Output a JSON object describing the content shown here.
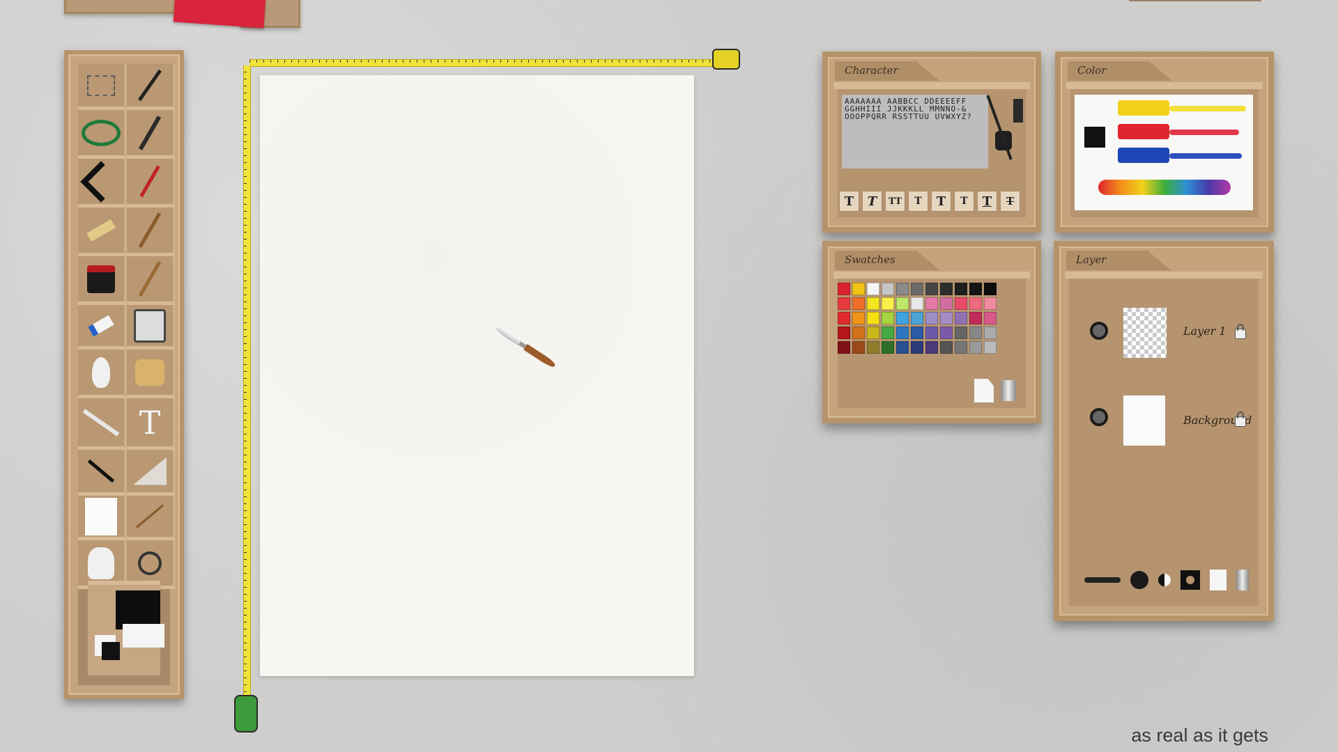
{
  "panels": {
    "character": {
      "title": "Character",
      "letter_sheet": "AAAAAAA AABBCC DDEEEEFF GGHHIII JJKKKLL MMNNO-& OOOPPQRR RSSTTUU UVWXYZ?",
      "type_tiles": [
        "T",
        "T",
        "TT",
        "T",
        "T",
        "T",
        "T",
        "T"
      ]
    },
    "color": {
      "title": "Color",
      "tube_colors": [
        "#f2d11b",
        "#e0252f",
        "#1d47b5"
      ]
    },
    "swatches": {
      "title": "Swatches",
      "colors": [
        "#d9232e",
        "#f1c315",
        "#f5f5f5",
        "#c6c6c6",
        "#8a8a8a",
        "#6b6b6b",
        "#464646",
        "#2d2d2d",
        "#1f1f1f",
        "#151515",
        "#0d0d0d",
        "#e73b3f",
        "#f06d2a",
        "#f5e51e",
        "#fbf04b",
        "#bde86a",
        "#e8e8e8",
        "#e67aa6",
        "#d36ea0",
        "#e84a6a",
        "#f06a7e",
        "#f08a9e",
        "#e02a2f",
        "#f2941b",
        "#f7df14",
        "#a5d43f",
        "#3fa3e0",
        "#4ba3d8",
        "#9c8ec5",
        "#a58cc2",
        "#9173b5",
        "#c02a5a",
        "#d85a8a",
        "#b3161d",
        "#d4721a",
        "#c9b81a",
        "#46a93f",
        "#2e77c0",
        "#2d5aa5",
        "#6a5aa8",
        "#7a5aa8",
        "#666",
        "#888",
        "#aaa",
        "#7f1218",
        "#9a4a1a",
        "#8f7d2c",
        "#2f6f2c",
        "#2a4f8f",
        "#2d3a7a",
        "#4b3a7a",
        "#555",
        "#777",
        "#999",
        "#bbb"
      ]
    },
    "layer": {
      "title": "Layer",
      "layers": [
        {
          "name": "Layer 1",
          "thumbnail": "checkerboard"
        },
        {
          "name": "Background",
          "thumbnail": "white"
        }
      ]
    }
  },
  "tagline": "as real as it gets",
  "icons": {
    "visibility": "eye-icon",
    "lock": "lock-icon"
  }
}
